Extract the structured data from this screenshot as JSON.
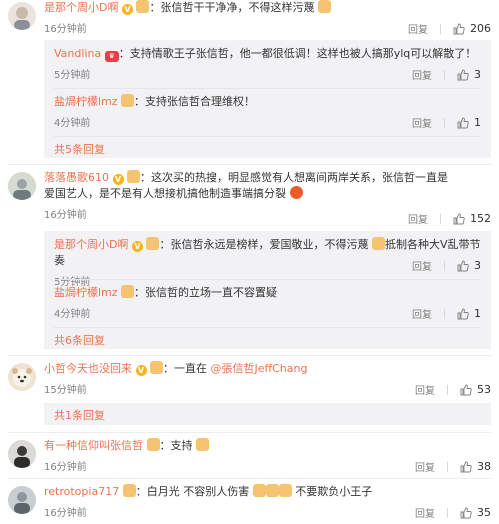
{
  "actions": {
    "reply": "回复"
  },
  "comments": [
    {
      "user": "是那个周小D啊",
      "text": "张信哲干干净净，不得这样污蔑",
      "time": "16分钟前",
      "likes": "206",
      "subs": [
        {
          "user": "Vandlina",
          "text": "支持情歌王子张信哲，他一都很低调！这样也被人搞那ylq可以解散了！",
          "time": "5分钟前",
          "likes": "3"
        },
        {
          "user": "盐焗柠檬lmz",
          "text": "支持张信哲合理维权！",
          "time": "4分钟前",
          "likes": "1"
        }
      ],
      "more": "共5条回复"
    },
    {
      "user": "落落愚歌610",
      "text": "这次买的热搜，明显感觉有人想离间两岸关系，张信哲一直是爱国艺人，是不是有人想接机搞他制造事端搞分裂",
      "time": "16分钟前",
      "likes": "152",
      "subs": [
        {
          "user": "是那个周小D啊",
          "text": "张信哲永远是榜样，爱国敬业，不得污蔑",
          "text2": "抵制各种大V乱带节奏",
          "time": "5分钟前",
          "likes": "3"
        },
        {
          "user": "盐焗柠檬lmz",
          "text": "张信哲的立场一直不容置疑",
          "time": "4分钟前",
          "likes": "1"
        }
      ],
      "more": "共6条回复"
    },
    {
      "user": "小哲今天也没回来",
      "text_prefix": "一直在",
      "mention": "@張信哲JeffChang",
      "time": "15分钟前",
      "likes": "53",
      "more": "共1条回复"
    },
    {
      "user": "有一种信仰叫张信哲",
      "text": "支持",
      "time": "16分钟前",
      "likes": "38"
    },
    {
      "user": "retrotopia717",
      "text": "白月光 不容别人伤害",
      "text2": "不要欺负小王子",
      "time": "16分钟前",
      "likes": "35"
    }
  ]
}
